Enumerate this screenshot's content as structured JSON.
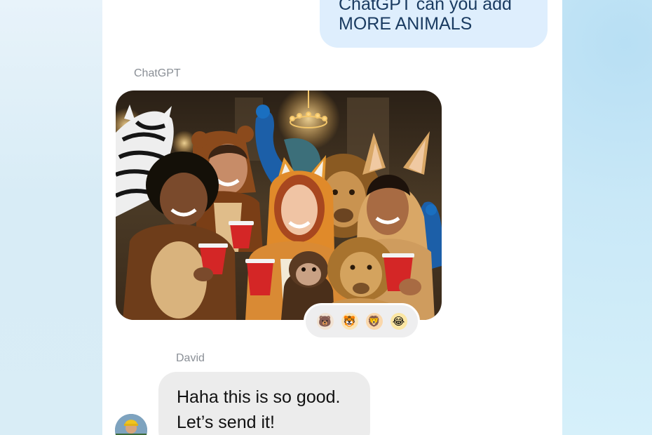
{
  "conversation": {
    "user_message": {
      "lines": [
        "ChatGPT can you add",
        "MORE ANIMALS"
      ]
    },
    "assistant": {
      "sender": "ChatGPT",
      "image": {
        "subject": "people-in-animal-onesies-party-photo"
      },
      "reactions": [
        {
          "emoji": "🐻",
          "icon": "bear-face-icon",
          "color": "#8a5a33"
        },
        {
          "emoji": "🐯",
          "icon": "tiger-face-icon",
          "color": "#f2a423"
        },
        {
          "emoji": "🦁",
          "icon": "lion-face-icon",
          "color": "#e08a1e"
        },
        {
          "emoji": "😂",
          "icon": "tears-of-joy-icon",
          "color": "#f4c22b"
        }
      ]
    },
    "reply": {
      "sender": "David",
      "lines": [
        "Haha this is so good.",
        "Let’s send it!"
      ]
    }
  },
  "colors": {
    "user_bubble": "#deeefd",
    "user_text": "#1a3b61",
    "reply_bubble": "#ececec",
    "sender_label": "#8a8f96"
  }
}
